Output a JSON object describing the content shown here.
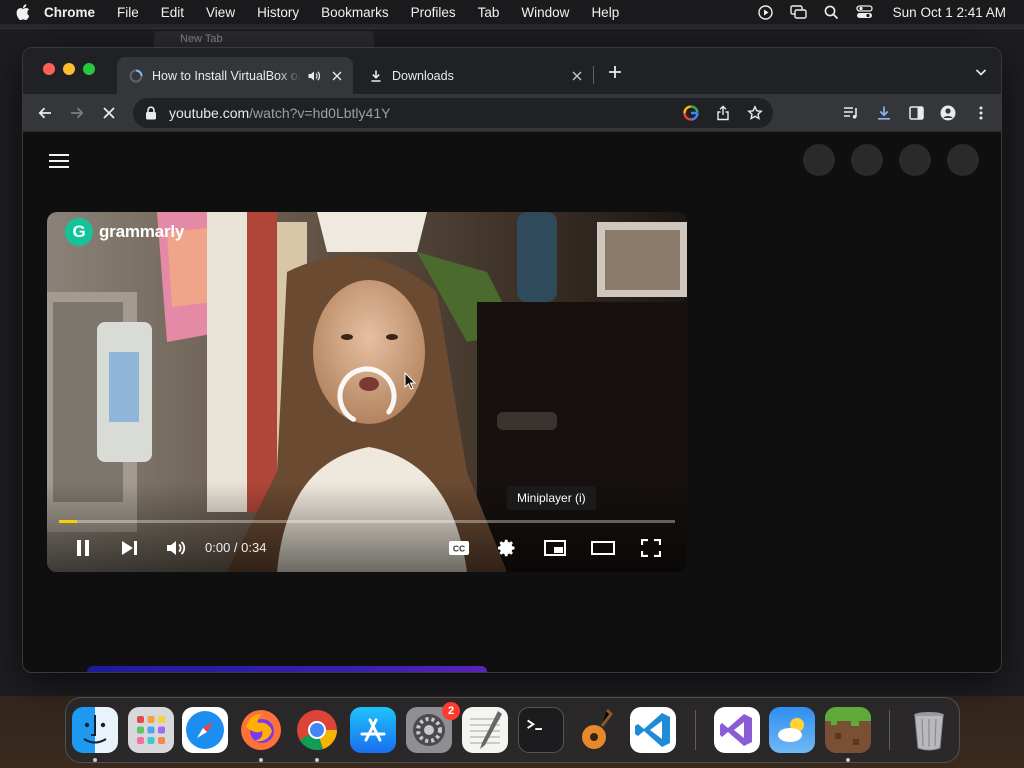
{
  "menubar": {
    "app_name": "Chrome",
    "items": [
      "File",
      "Edit",
      "View",
      "History",
      "Bookmarks",
      "Profiles",
      "Tab",
      "Window",
      "Help"
    ],
    "clock": "Sun Oct 1  2:41 AM",
    "status_icons": [
      "play-circle-icon",
      "screen-mirror-icon",
      "spotlight-search-icon",
      "control-center-icon"
    ]
  },
  "background_window": {
    "tab_title": "New Tab"
  },
  "browser": {
    "tabs": [
      {
        "title": "How to Install VirtualBox on",
        "icon": "youtube-loading-icon",
        "active": true,
        "audio": true
      },
      {
        "title": "Downloads",
        "icon": "download-icon",
        "active": false,
        "audio": false
      }
    ],
    "url_host": "youtube.com",
    "url_path": "/watch?v=hd0Lbtly41Y",
    "accent": "#8ab4f8"
  },
  "player": {
    "brand": "grammarly",
    "brand_color": "#15c39a",
    "time": "0:00 / 0:34",
    "tooltip": "Miniplayer (i)",
    "progress_fraction": 0.0,
    "buffer_fraction": 0.03,
    "loading": true
  },
  "dock": {
    "apps": [
      {
        "name": "Finder",
        "running": true
      },
      {
        "name": "Launchpad",
        "running": false
      },
      {
        "name": "Safari",
        "running": false
      },
      {
        "name": "Firefox",
        "running": true
      },
      {
        "name": "Google Chrome",
        "running": true
      },
      {
        "name": "App Store",
        "running": false
      },
      {
        "name": "System Settings",
        "running": false,
        "badge": "2"
      },
      {
        "name": "TextEdit",
        "running": false
      },
      {
        "name": "Terminal",
        "running": false
      },
      {
        "name": "GarageBand",
        "running": false
      },
      {
        "name": "Visual Studio Code",
        "running": false
      },
      {
        "name": "Visual Studio",
        "running": false
      },
      {
        "name": "Weather",
        "running": false
      },
      {
        "name": "Minecraft",
        "running": true
      },
      {
        "name": "Trash",
        "running": false
      }
    ]
  }
}
